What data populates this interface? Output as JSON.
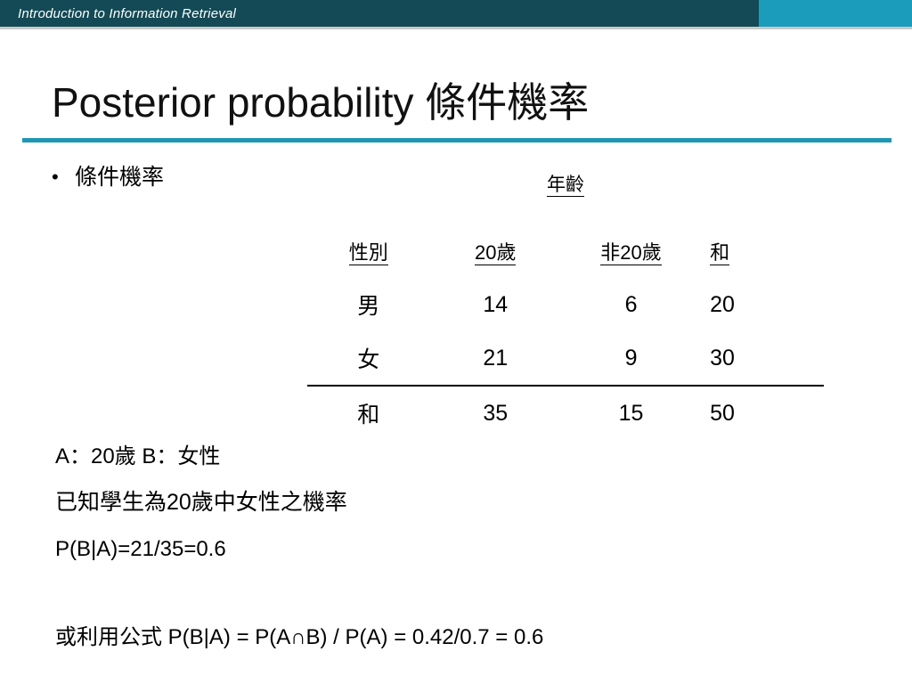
{
  "banner": {
    "title": "Introduction to Information Retrieval",
    "left_color": "#134a55",
    "right_color": "#1a9cba"
  },
  "slide": {
    "title": "Posterior probability 條件機率",
    "rule_color": "#1f97b4",
    "bullet_marker": "•",
    "bullet_text": "條件機率"
  },
  "table": {
    "group_header": "年齡",
    "columns": [
      "性別",
      "20歲",
      "非20歲",
      "和"
    ],
    "rows": [
      {
        "label": "男",
        "values": [
          "14",
          "6",
          "20"
        ]
      },
      {
        "label": "女",
        "values": [
          "21",
          "9",
          "30"
        ]
      }
    ],
    "totals": {
      "label": "和",
      "values": [
        "35",
        "15",
        "50"
      ]
    }
  },
  "notes": {
    "events": "A：20歲 B：女性",
    "description": "已知學生為20歲中女性之機率",
    "calculation": "P(B|A)=21/35=0.6",
    "formula": "或利用公式 P(B|A) = P(A∩B) / P(A) = 0.42/0.7 = 0.6"
  }
}
